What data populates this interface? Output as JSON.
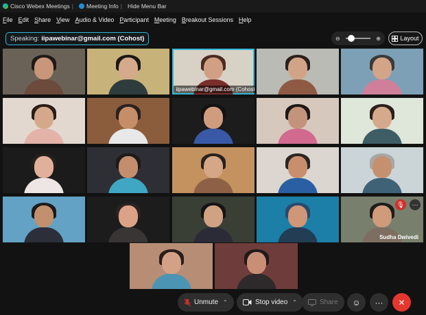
{
  "titlebar": {
    "app_name": "Cisco Webex Meetings",
    "meeting_info": "Meeting Info",
    "hide_menu": "Hide Menu Bar"
  },
  "menu": [
    "File",
    "Edit",
    "Share",
    "View",
    "Audio & Video",
    "Participant",
    "Meeting",
    "Breakout Sessions",
    "Help"
  ],
  "speaking": {
    "label": "Speaking:",
    "name": "iipawebinar@gmail.com (Cohost)"
  },
  "zoom": {
    "level": 0.1
  },
  "layout_label": "Layout",
  "tiles": [
    {
      "bg": "#6b6257",
      "skin": "#c99679",
      "hair": "#1e1a18",
      "shirt": "#6c4a3c"
    },
    {
      "bg": "#c7b37a",
      "skin": "#d5a98c",
      "hair": "#1c1715",
      "shirt": "#2f3c3e"
    },
    {
      "bg": "#d8d1c6",
      "skin": "#d19f84",
      "hair": "#4a2c1f",
      "shirt": "#7b2f2d",
      "label": "iipawebinar@gmail.com  (Cohost)",
      "active": true
    },
    {
      "bg": "#b9bbb4",
      "skin": "#d2a487",
      "hair": "#2b211c",
      "shirt": "#8f5a44"
    },
    {
      "bg": "#7ea0b7",
      "skin": "#d3a487",
      "hair": "#3a3a3a",
      "shirt": "#d07f9a"
    },
    {
      "bg": "#e2d8d0",
      "skin": "#d6a88b",
      "hair": "#2a1d18",
      "shirt": "#e3b2a9"
    },
    {
      "bg": "#8b5d3c",
      "skin": "#c58e68",
      "hair": "#2a2120",
      "shirt": "#e8e8e8"
    },
    {
      "bg": "#1c1c1c",
      "skin": "#cf9d7e",
      "hair": "#141110",
      "shirt": "#3958a6"
    },
    {
      "bg": "#d6c8bd",
      "skin": "#c4937b",
      "hair": "#1e1715",
      "shirt": "#d26a8f"
    },
    {
      "bg": "#dfe6da",
      "skin": "#d5a98c",
      "hair": "#2a201c",
      "shirt": "#3e5d64"
    },
    {
      "bg": "#1b1b1b",
      "skin": "#e1b09a",
      "hair": "#24201e",
      "shirt": "#ede6e4"
    },
    {
      "bg": "#2e2f35",
      "skin": "#c48e6e",
      "hair": "#1d1a19",
      "shirt": "#3fa7c4"
    },
    {
      "bg": "#c4925f",
      "skin": "#d5a786",
      "hair": "#2a211d",
      "shirt": "#8e6147"
    },
    {
      "bg": "#dbd6cf",
      "skin": "#c98e6d",
      "hair": "#2b2523",
      "shirt": "#2a5fa4"
    },
    {
      "bg": "#cbd4d6",
      "skin": "#c5906f",
      "hair": "#a7a7a7",
      "shirt": "#3f6276"
    },
    {
      "bg": "#63a2c4",
      "skin": "#c2906f",
      "hair": "#1d1a1a",
      "shirt": "#2c2f3a"
    },
    {
      "bg": "#1c1c1c",
      "skin": "#dca287",
      "hair": "#2b2221",
      "shirt": "#3a3535"
    },
    {
      "bg": "#3a3f36",
      "skin": "#d0a183",
      "hair": "#151413",
      "shirt": "#2b2b38"
    },
    {
      "bg": "#1c7fa7",
      "skin": "#cf9678",
      "hair": "#2a4a6c",
      "shirt": "#233d55"
    },
    {
      "bg": "#78806d",
      "skin": "#cf9b7a",
      "hair": "#1f1b19",
      "shirt": "#7e6e61",
      "label": "Sudha Dwivedi",
      "label_right": true,
      "icons": true
    }
  ],
  "bottom_tiles": [
    {
      "bg": "#b78d75",
      "skin": "#d3a286",
      "hair": "#2a1e1a",
      "shirt": "#4c94b3"
    },
    {
      "bg": "#6e3c3a",
      "skin": "#c98f76",
      "hair": "#201a1a",
      "shirt": "#2e2a2c"
    }
  ],
  "controls": {
    "unmute": "Unmute",
    "stop_video": "Stop video",
    "share": "Share"
  },
  "colors": {
    "accent": "#2fb9d9",
    "end_call": "#e5372f",
    "mic_muted": "#d0312d"
  }
}
